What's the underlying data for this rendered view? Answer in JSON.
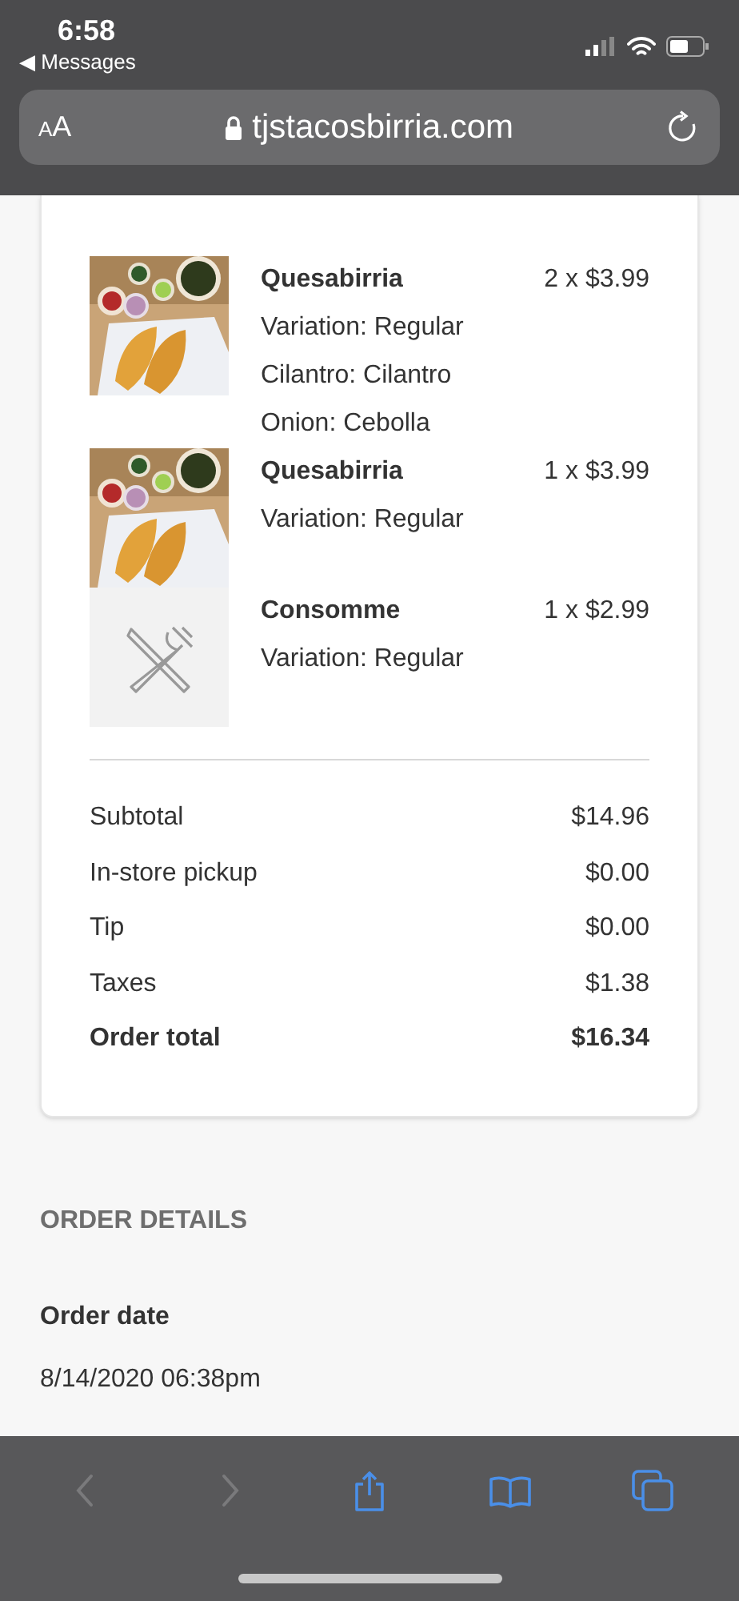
{
  "status_bar": {
    "time": "6:58",
    "back_link": "◀ Messages"
  },
  "address_bar": {
    "text_size_label": "AA",
    "url": "tjstacosbirria.com"
  },
  "order": {
    "items": [
      {
        "name": "Quesabirria",
        "quantity_price": "2 x $3.99",
        "details": [
          "Variation: Regular",
          "Cilantro: Cilantro",
          "Onion: Cebolla"
        ],
        "kind": "picture"
      },
      {
        "name": "Quesabirria",
        "quantity_price": "1 x $3.99",
        "details": [
          "Variation: Regular"
        ],
        "kind": "picture"
      },
      {
        "name": "Consomme",
        "quantity_price": "1 x $2.99",
        "details": [
          "Variation: Regular"
        ],
        "kind": "placeholder"
      }
    ],
    "summary": [
      {
        "label": "Subtotal",
        "value": "$14.96",
        "emphasis": false
      },
      {
        "label": "In-store pickup",
        "value": "$0.00",
        "emphasis": false
      },
      {
        "label": "Tip",
        "value": "$0.00",
        "emphasis": false
      },
      {
        "label": "Taxes",
        "value": "$1.38",
        "emphasis": false
      },
      {
        "label": "Order total",
        "value": "$16.34",
        "emphasis": true
      }
    ]
  },
  "order_details": {
    "heading": "ORDER DETAILS",
    "fields": [
      {
        "label": "Order date",
        "value": "8/14/2020 06:38pm"
      }
    ]
  },
  "toolbar": {
    "buttons": [
      {
        "kind": "back",
        "disabled": true
      },
      {
        "kind": "forward",
        "disabled": true
      },
      {
        "kind": "share",
        "disabled": false
      },
      {
        "kind": "bookmarks",
        "disabled": false
      },
      {
        "kind": "tabs",
        "disabled": false
      }
    ]
  }
}
